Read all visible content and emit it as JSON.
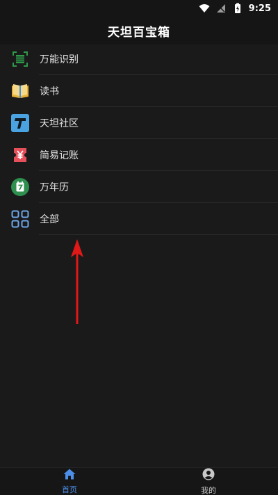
{
  "status": {
    "time": "9:25",
    "icons": [
      "wifi-icon",
      "signal-icon",
      "battery-charging-icon"
    ]
  },
  "header": {
    "title": "天坦百宝箱"
  },
  "list": {
    "items": [
      {
        "label": "万能识别",
        "icon": "scan-icon",
        "color": "#2f9a4a"
      },
      {
        "label": "读书",
        "icon": "book-icon",
        "color": "#e9b233"
      },
      {
        "label": "天坦社区",
        "icon": "community-t-icon",
        "color": "#4aa3e0"
      },
      {
        "label": "简易记账",
        "icon": "ledger-yen-icon",
        "color": "#e6505a"
      },
      {
        "label": "万年历",
        "icon": "calendar-icon",
        "color": "#2f8f4e"
      },
      {
        "label": "全部",
        "icon": "grid-icon",
        "color": "#6ea8e8"
      }
    ]
  },
  "bottom_nav": {
    "items": [
      {
        "label": "首页",
        "icon": "home-icon",
        "active": true,
        "color": "#4c8ee8"
      },
      {
        "label": "我的",
        "icon": "profile-icon",
        "active": false,
        "color": "#c8c8c8"
      }
    ]
  },
  "annotation": {
    "icon": "red-arrow-up-icon",
    "color": "#e01818"
  }
}
